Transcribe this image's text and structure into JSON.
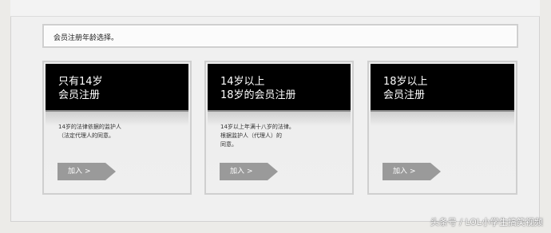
{
  "notice": {
    "text": "会员注册年龄选择。"
  },
  "cards": [
    {
      "title_line1": "只有14岁",
      "title_line2": "会员注册",
      "desc": [
        "14岁的法律依据的监护人",
        "（法定代理人的同意。"
      ],
      "button_label": "加入",
      "button_arrow": ">"
    },
    {
      "title_line1": "14岁以上",
      "title_line2": "18岁的会员注册",
      "desc": [
        "14岁以上年满十八岁的法律。",
        "根据监护人（代理人）的",
        "同意。"
      ],
      "button_label": "加入",
      "button_arrow": ">"
    },
    {
      "title_line1": "18岁以上",
      "title_line2": "会员注册",
      "desc": [],
      "button_label": "加入",
      "button_arrow": ">"
    }
  ],
  "watermark": {
    "text": "头条号 / LOL小学生搞笑视频"
  }
}
